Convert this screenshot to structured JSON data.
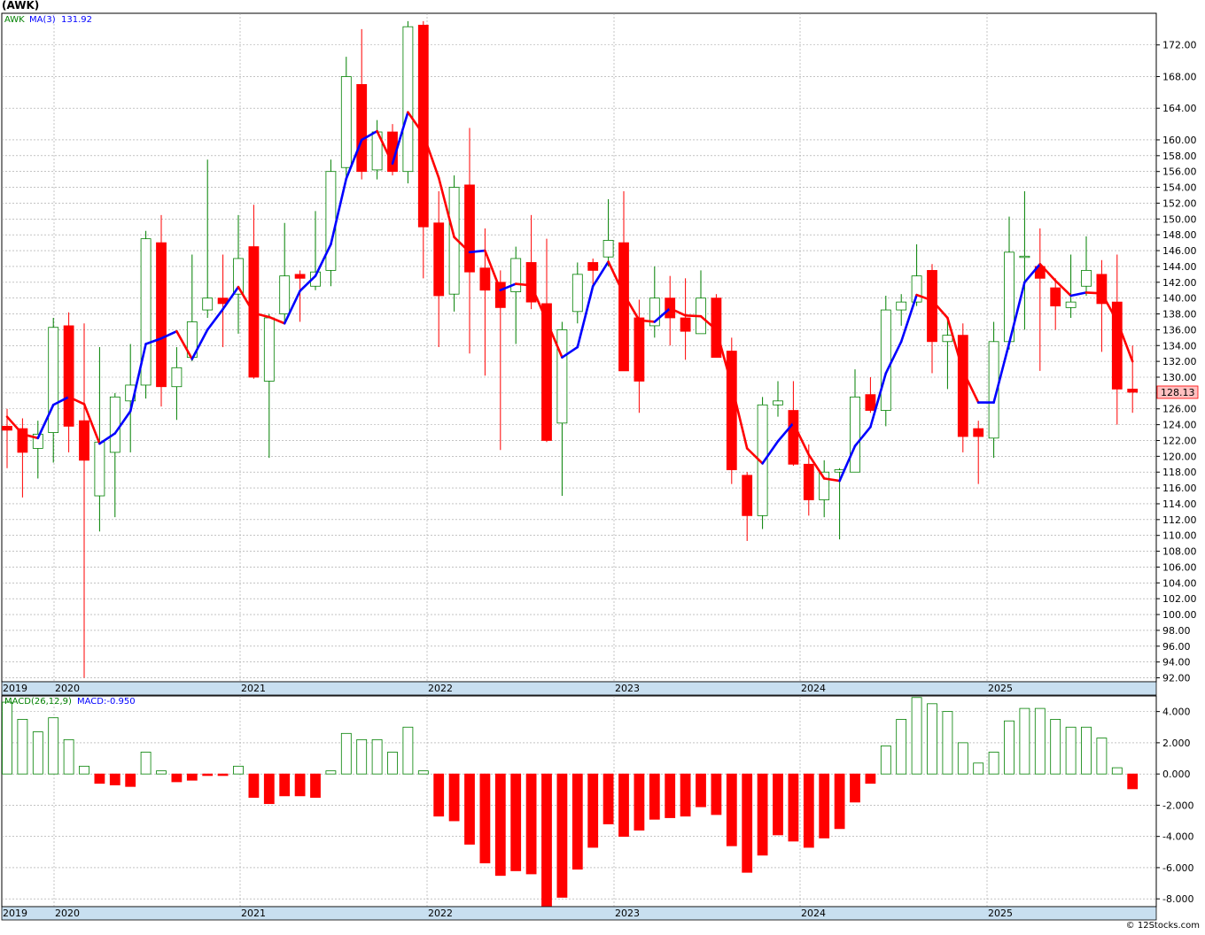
{
  "ticker": "(AWK)",
  "copyright": "© 12Stocks.com",
  "legend": {
    "symbol": "AWK",
    "ma_label": "MA(3)",
    "ma_value": "131.92",
    "macd_label": "MACD(26,12,9)",
    "macd_value": "MACD:-0.950"
  },
  "last_price": "128.13",
  "colors": {
    "up": "#008000",
    "down": "#ff0000",
    "ma_up": "#0000ff",
    "ma_down": "#ff0000",
    "grid": "#a0a0a0",
    "price_label_bg": "#ffc0c0"
  },
  "chart_data": [
    {
      "type": "candlestick",
      "x_labels": [
        "2019",
        "2020",
        "2021",
        "2022",
        "2023",
        "2024",
        "2025"
      ],
      "ylim": [
        91.5,
        176
      ],
      "y_ticks": [
        "92.00",
        "94.00",
        "96.00",
        "98.00",
        "100.00",
        "102.00",
        "104.00",
        "106.00",
        "108.00",
        "110.00",
        "112.00",
        "114.00",
        "116.00",
        "118.00",
        "120.00",
        "122.00",
        "124.00",
        "126.00",
        "128.00",
        "130.00",
        "132.00",
        "134.00",
        "136.00",
        "138.00",
        "140.00",
        "142.00",
        "144.00",
        "146.00",
        "148.00",
        "150.00",
        "152.00",
        "154.00",
        "156.00",
        "158.00",
        "160.00",
        "164.00",
        "168.00",
        "172.00"
      ],
      "candles": [
        {
          "o": 123.8,
          "h": 126.0,
          "l": 118.5,
          "c": 123.3
        },
        {
          "o": 123.5,
          "h": 124.8,
          "l": 114.8,
          "c": 120.5
        },
        {
          "o": 121.0,
          "h": 124.5,
          "l": 117.2,
          "c": 122.8
        },
        {
          "o": 123.0,
          "h": 137.5,
          "l": 119.2,
          "c": 136.3
        },
        {
          "o": 136.5,
          "h": 138.2,
          "l": 120.5,
          "c": 123.8
        },
        {
          "o": 124.5,
          "h": 136.8,
          "l": 92.0,
          "c": 119.5
        },
        {
          "o": 115.0,
          "h": 133.8,
          "l": 110.5,
          "c": 121.8
        },
        {
          "o": 120.5,
          "h": 128.0,
          "l": 112.3,
          "c": 127.5
        },
        {
          "o": 127.0,
          "h": 134.2,
          "l": 120.5,
          "c": 129.0
        },
        {
          "o": 129.0,
          "h": 148.5,
          "l": 127.3,
          "c": 147.5
        },
        {
          "o": 147.0,
          "h": 150.5,
          "l": 126.3,
          "c": 128.8
        },
        {
          "o": 128.8,
          "h": 133.8,
          "l": 124.6,
          "c": 131.2
        },
        {
          "o": 132.5,
          "h": 145.5,
          "l": 132.0,
          "c": 137.0
        },
        {
          "o": 138.5,
          "h": 157.5,
          "l": 137.5,
          "c": 140.0
        },
        {
          "o": 140.0,
          "h": 145.5,
          "l": 133.8,
          "c": 139.3
        },
        {
          "o": 140.5,
          "h": 150.5,
          "l": 135.5,
          "c": 145.0
        },
        {
          "o": 146.5,
          "h": 151.8,
          "l": 129.8,
          "c": 130.0
        },
        {
          "o": 129.5,
          "h": 138.0,
          "l": 119.8,
          "c": 137.5
        },
        {
          "o": 138.0,
          "h": 149.5,
          "l": 136.8,
          "c": 142.8
        },
        {
          "o": 143.0,
          "h": 143.5,
          "l": 137.0,
          "c": 142.5
        },
        {
          "o": 141.5,
          "h": 151.0,
          "l": 141.0,
          "c": 143.3
        },
        {
          "o": 143.5,
          "h": 157.5,
          "l": 141.5,
          "c": 156.0
        },
        {
          "o": 156.5,
          "h": 170.5,
          "l": 155.0,
          "c": 168.0
        },
        {
          "o": 167.0,
          "h": 174.0,
          "l": 155.0,
          "c": 156.0
        },
        {
          "o": 156.2,
          "h": 162.5,
          "l": 155.0,
          "c": 161.0
        },
        {
          "o": 161.0,
          "h": 162.0,
          "l": 155.5,
          "c": 156.0
        },
        {
          "o": 156.0,
          "h": 175.0,
          "l": 154.5,
          "c": 174.3
        },
        {
          "o": 174.5,
          "h": 175.0,
          "l": 142.5,
          "c": 149.0
        },
        {
          "o": 149.5,
          "h": 153.5,
          "l": 133.8,
          "c": 140.3
        },
        {
          "o": 140.5,
          "h": 155.5,
          "l": 138.3,
          "c": 154.0
        },
        {
          "o": 154.3,
          "h": 161.5,
          "l": 133.0,
          "c": 143.3
        },
        {
          "o": 143.8,
          "h": 148.8,
          "l": 130.2,
          "c": 141.0
        },
        {
          "o": 142.0,
          "h": 143.5,
          "l": 120.8,
          "c": 138.8
        },
        {
          "o": 140.8,
          "h": 146.5,
          "l": 134.2,
          "c": 145.0
        },
        {
          "o": 144.5,
          "h": 150.5,
          "l": 138.6,
          "c": 139.5
        },
        {
          "o": 139.3,
          "h": 147.5,
          "l": 121.8,
          "c": 122.0
        },
        {
          "o": 124.2,
          "h": 137.0,
          "l": 115.0,
          "c": 136.0
        },
        {
          "o": 138.3,
          "h": 144.5,
          "l": 136.8,
          "c": 143.0
        },
        {
          "o": 144.5,
          "h": 145.0,
          "l": 141.5,
          "c": 143.5
        },
        {
          "o": 145.2,
          "h": 152.5,
          "l": 144.0,
          "c": 147.3
        },
        {
          "o": 147.0,
          "h": 153.5,
          "l": 132.5,
          "c": 130.8
        },
        {
          "o": 137.5,
          "h": 139.8,
          "l": 125.5,
          "c": 129.5
        },
        {
          "o": 136.5,
          "h": 144.0,
          "l": 135.0,
          "c": 140.0
        },
        {
          "o": 140.0,
          "h": 142.8,
          "l": 134.0,
          "c": 137.5
        },
        {
          "o": 137.5,
          "h": 142.5,
          "l": 132.2,
          "c": 135.8
        },
        {
          "o": 135.5,
          "h": 143.5,
          "l": 135.5,
          "c": 140.0
        },
        {
          "o": 140.0,
          "h": 140.5,
          "l": 132.5,
          "c": 132.5
        },
        {
          "o": 133.3,
          "h": 135.0,
          "l": 116.5,
          "c": 118.3
        },
        {
          "o": 117.6,
          "h": 118.0,
          "l": 109.3,
          "c": 112.5
        },
        {
          "o": 112.5,
          "h": 127.5,
          "l": 110.8,
          "c": 126.5
        },
        {
          "o": 126.5,
          "h": 129.5,
          "l": 125.0,
          "c": 127.0
        },
        {
          "o": 125.8,
          "h": 129.5,
          "l": 118.8,
          "c": 119.0
        },
        {
          "o": 119.0,
          "h": 121.5,
          "l": 112.5,
          "c": 114.5
        },
        {
          "o": 114.5,
          "h": 119.5,
          "l": 112.3,
          "c": 118.0
        },
        {
          "o": 118.0,
          "h": 118.5,
          "l": 109.5,
          "c": 118.3
        },
        {
          "o": 118.0,
          "h": 131.0,
          "l": 118.0,
          "c": 127.5
        },
        {
          "o": 127.8,
          "h": 130.0,
          "l": 125.5,
          "c": 125.8
        },
        {
          "o": 125.8,
          "h": 140.3,
          "l": 123.8,
          "c": 138.5
        },
        {
          "o": 138.5,
          "h": 140.5,
          "l": 136.5,
          "c": 139.5
        },
        {
          "o": 139.5,
          "h": 146.8,
          "l": 139.0,
          "c": 142.8
        },
        {
          "o": 143.5,
          "h": 144.3,
          "l": 130.5,
          "c": 134.5
        },
        {
          "o": 134.5,
          "h": 137.5,
          "l": 128.5,
          "c": 135.3
        },
        {
          "o": 135.3,
          "h": 136.8,
          "l": 120.5,
          "c": 122.5
        },
        {
          "o": 123.5,
          "h": 124.5,
          "l": 116.5,
          "c": 122.5
        },
        {
          "o": 122.3,
          "h": 137.0,
          "l": 119.8,
          "c": 134.5
        },
        {
          "o": 134.5,
          "h": 150.3,
          "l": 133.5,
          "c": 145.8
        },
        {
          "o": 145.3,
          "h": 153.5,
          "l": 136.0,
          "c": 145.3
        },
        {
          "o": 144.0,
          "h": 148.8,
          "l": 130.8,
          "c": 142.5
        },
        {
          "o": 141.3,
          "h": 142.5,
          "l": 136.0,
          "c": 139.0
        },
        {
          "o": 138.8,
          "h": 145.5,
          "l": 137.5,
          "c": 139.5
        },
        {
          "o": 141.5,
          "h": 147.8,
          "l": 140.3,
          "c": 143.5
        },
        {
          "o": 143.0,
          "h": 144.8,
          "l": 133.2,
          "c": 139.3
        },
        {
          "o": 139.5,
          "h": 145.5,
          "l": 124.0,
          "c": 128.5
        },
        {
          "o": 128.5,
          "h": 134.0,
          "l": 125.5,
          "c": 128.1
        }
      ],
      "ma": [
        125.0,
        122.8,
        122.3,
        126.5,
        127.5,
        126.6,
        121.6,
        122.9,
        125.7,
        134.2,
        134.9,
        135.8,
        132.3,
        136.0,
        138.6,
        141.4,
        138.1,
        137.6,
        136.8,
        140.9,
        142.8,
        146.8,
        155.1,
        160.0,
        161.1,
        157.0,
        163.5,
        160.7,
        155.2,
        147.7,
        145.8,
        146.0,
        141.0,
        141.8,
        141.6,
        137.1,
        132.5,
        133.8,
        141.5,
        144.6,
        140.5,
        137.2,
        137.0,
        138.7,
        137.8,
        137.7,
        136.0,
        129.0,
        121.0,
        119.1,
        121.9,
        124.2,
        120.2,
        117.2,
        116.9,
        121.3,
        123.7,
        130.5,
        134.5,
        140.4,
        139.7,
        137.5,
        130.8,
        126.8,
        126.8,
        134.3,
        142.0,
        144.3,
        142.2,
        140.3,
        140.7,
        140.6,
        137.1,
        132.0
      ]
    },
    {
      "type": "bar",
      "x_labels": [
        "2019",
        "2020",
        "2021",
        "2022",
        "2023",
        "2024",
        "2025"
      ],
      "ylim": [
        -8.5,
        5.0
      ],
      "y_ticks": [
        "-8.000",
        "-6.000",
        "-4.000",
        "-2.000",
        "0.000",
        "2.000",
        "4.000"
      ],
      "values": [
        4.6,
        3.5,
        2.7,
        3.6,
        2.2,
        0.5,
        -0.6,
        -0.7,
        -0.8,
        1.4,
        0.2,
        -0.5,
        -0.4,
        -0.1,
        -0.1,
        0.5,
        -1.5,
        -1.9,
        -1.4,
        -1.4,
        -1.5,
        0.2,
        2.6,
        2.2,
        2.2,
        1.4,
        3.0,
        0.2,
        -2.7,
        -3.0,
        -4.5,
        -5.7,
        -6.5,
        -6.2,
        -6.4,
        -8.5,
        -7.9,
        -6.1,
        -4.7,
        -3.2,
        -4.0,
        -3.6,
        -2.9,
        -2.8,
        -2.7,
        -2.1,
        -2.6,
        -4.6,
        -6.3,
        -5.2,
        -3.9,
        -4.3,
        -4.7,
        -4.1,
        -3.5,
        -1.8,
        -0.6,
        1.8,
        3.5,
        4.9,
        4.5,
        4.0,
        2.0,
        0.7,
        1.4,
        3.4,
        4.2,
        4.2,
        3.5,
        3.0,
        3.0,
        2.3,
        0.4,
        -0.95
      ]
    }
  ]
}
